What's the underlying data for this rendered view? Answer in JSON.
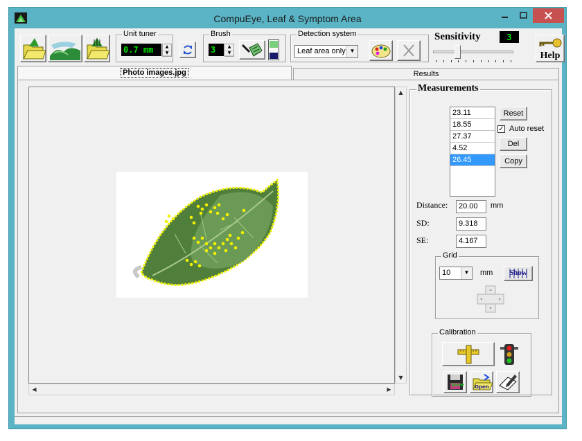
{
  "window": {
    "title": "CompuEye, Leaf & Symptom Area"
  },
  "toolbar": {
    "unit_tuner": {
      "label": "Unit tuner",
      "value": "0.7 mm"
    },
    "brush": {
      "label": "Brush",
      "value": "3"
    },
    "detection": {
      "label": "Detection system",
      "selected": "Leaf area only"
    },
    "sensitivity": {
      "label": "Sensitivity",
      "value": "3",
      "level_fraction": 0.3
    },
    "help_label": "Help"
  },
  "tabs": [
    {
      "label": "Photo images.jpg",
      "active": true
    },
    {
      "label": "Results",
      "active": false
    }
  ],
  "measurements": {
    "title": "Measurements",
    "values": [
      "23.11",
      "18.55",
      "27.37",
      "4.52",
      "26.45"
    ],
    "selected_index": 4,
    "reset_label": "Reset",
    "auto_reset_label": "Auto reset",
    "auto_reset_checked": true,
    "del_label": "Del",
    "copy_label": "Copy"
  },
  "stats": {
    "distance_label": "Distance:",
    "distance_value": "20.00",
    "distance_unit": "mm",
    "sd_label": "SD:",
    "sd_value": "9.318",
    "se_label": "SE:",
    "se_value": "4.167"
  },
  "grid": {
    "label": "Grid",
    "value": "10",
    "unit": "mm",
    "show_label": "Show"
  },
  "calibration": {
    "label": "Calibration",
    "save_label": "Save",
    "open_label": "Open"
  },
  "colors": {
    "title_bar": "#5ab4c5",
    "close_button": "#c75050",
    "selection": "#3399ff",
    "lcd_text": "#00e000",
    "outline": "#f2f200"
  }
}
